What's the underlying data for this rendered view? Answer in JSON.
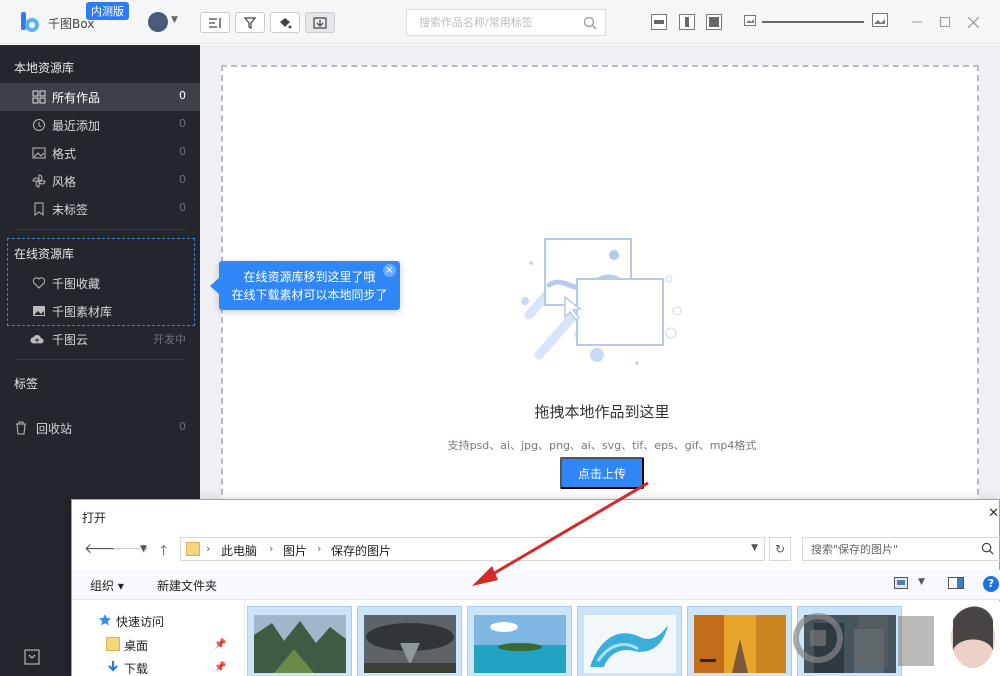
{
  "app": {
    "name": "千图Box",
    "badge": "内测版"
  },
  "search": {
    "placeholder": "搜索作品名称/常用标签"
  },
  "sidebar": {
    "local_section": "本地资源库",
    "local_items": [
      {
        "label": "所有作品",
        "count": "0",
        "icon": "grid-icon"
      },
      {
        "label": "最近添加",
        "count": "0",
        "icon": "clock-icon"
      },
      {
        "label": "格式",
        "count": "0",
        "icon": "image-format-icon"
      },
      {
        "label": "风格",
        "count": "0",
        "icon": "pinwheel-icon"
      },
      {
        "label": "未标签",
        "count": "0",
        "icon": "bookmark-icon"
      }
    ],
    "online_section": "在线资源库",
    "online_items": [
      {
        "label": "千图收藏",
        "icon": "heart-icon"
      },
      {
        "label": "千图素材库",
        "icon": "picture-icon"
      }
    ],
    "cloud": {
      "label": "千图云",
      "status": "开发中"
    },
    "tags_section": "标签",
    "trash": {
      "label": "回收站",
      "count": "0"
    }
  },
  "tooltip": {
    "line1": "在线资源库移到这里了哦",
    "line2": "在线下载素材可以本地同步了"
  },
  "drop": {
    "title": "拖拽本地作品到这里",
    "formats": "支持psd、ai、jpg、png、ai、svg、tif、eps、gif、mp4格式",
    "upload_label": "点击上传"
  },
  "dialog": {
    "title": "打开",
    "path": [
      "此电脑",
      "图片",
      "保存的图片"
    ],
    "search_placeholder": "搜索\"保存的图片\"",
    "toolbar": {
      "organize": "组织 ▾",
      "new_folder": "新建文件夹"
    },
    "nav": [
      {
        "label": "快速访问",
        "icon": "star-icon"
      },
      {
        "label": "桌面",
        "icon": "folder-icon"
      },
      {
        "label": "下载",
        "icon": "download-arrow-icon"
      }
    ],
    "thumbnails": [
      "mountain-valley",
      "storm-cloud",
      "tropical-island",
      "water-splash",
      "autumn-road",
      "building"
    ]
  },
  "colors": {
    "accent": "#2f86f6",
    "sidebar_bg": "#23262d",
    "arrow": "#d42a2a"
  }
}
